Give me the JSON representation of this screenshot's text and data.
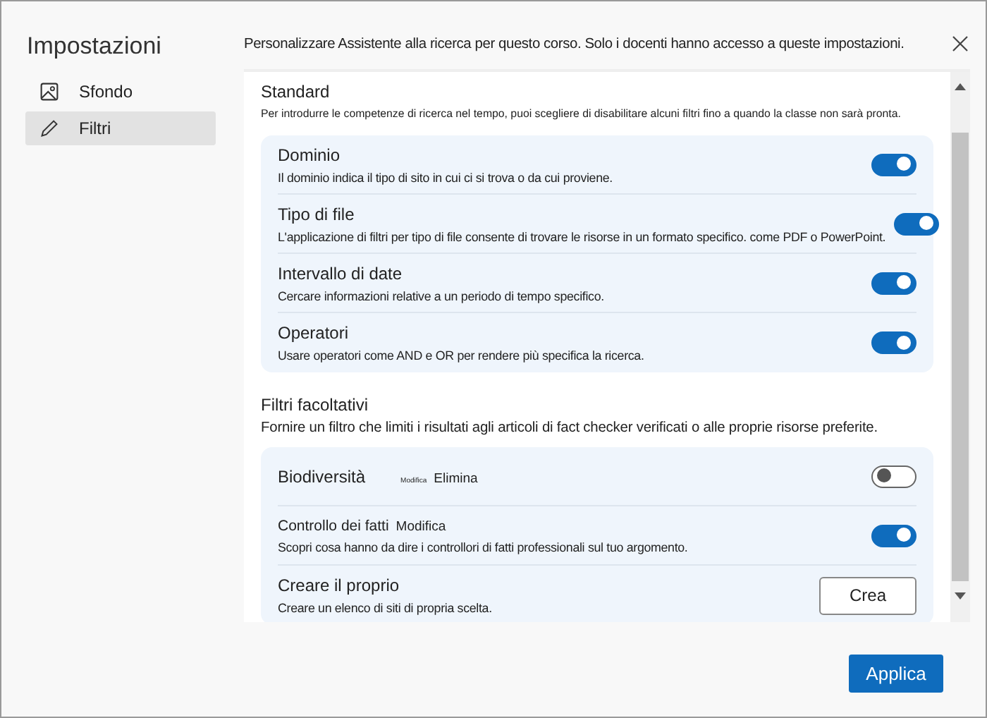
{
  "sidebar": {
    "title": "Impostazioni",
    "items": [
      {
        "label": "Sfondo",
        "selected": false
      },
      {
        "label": "Filtri",
        "selected": true
      }
    ]
  },
  "intro": "Personalizzare Assistente alla ricerca per questo corso. Solo i docenti hanno accesso a queste impostazioni.",
  "sections": [
    {
      "title": "Standard",
      "description": "Per introdurre le competenze di ricerca nel tempo, puoi scegliere di disabilitare alcuni filtri fino a quando la classe non sarà pronta.",
      "items": [
        {
          "kind": "toggle",
          "name": "Dominio",
          "description": "Il dominio indica il tipo di sito in cui ci si trova o da cui proviene.",
          "on": true
        },
        {
          "kind": "toggle",
          "name": "Tipo di file",
          "description": "L'applicazione di filtri per tipo di file consente di trovare le risorse in un formato specifico. come PDF o PowerPoint.",
          "on": true
        },
        {
          "kind": "toggle",
          "name": "Intervallo di date",
          "description": "Cercare informazioni relative a un periodo di tempo specifico.",
          "on": true
        },
        {
          "kind": "toggle",
          "name": "Operatori",
          "description": "Usare operatori come AND e OR per rendere più specifica la ricerca.",
          "on": true
        }
      ]
    },
    {
      "title": "Filtri facoltativi",
      "description": "Fornire un filtro che limiti i risultati agli articoli di fact checker verificati o alle proprie risorse preferite.",
      "items": [
        {
          "kind": "toggle",
          "name": "Biodiversità",
          "links": [
            "Modifica",
            "Elimina"
          ],
          "on": false
        },
        {
          "kind": "toggle",
          "name": "Controllo dei fatti",
          "links": [
            "Modifica"
          ],
          "description": "Scopri cosa hanno da dire i controllori di fatti professionali sul tuo argomento.",
          "on": true
        },
        {
          "kind": "button",
          "name": "Creare il proprio",
          "description": "Creare un elenco di siti di propria scelta.",
          "button": "Crea"
        }
      ]
    }
  ],
  "apply_button": "Applica"
}
